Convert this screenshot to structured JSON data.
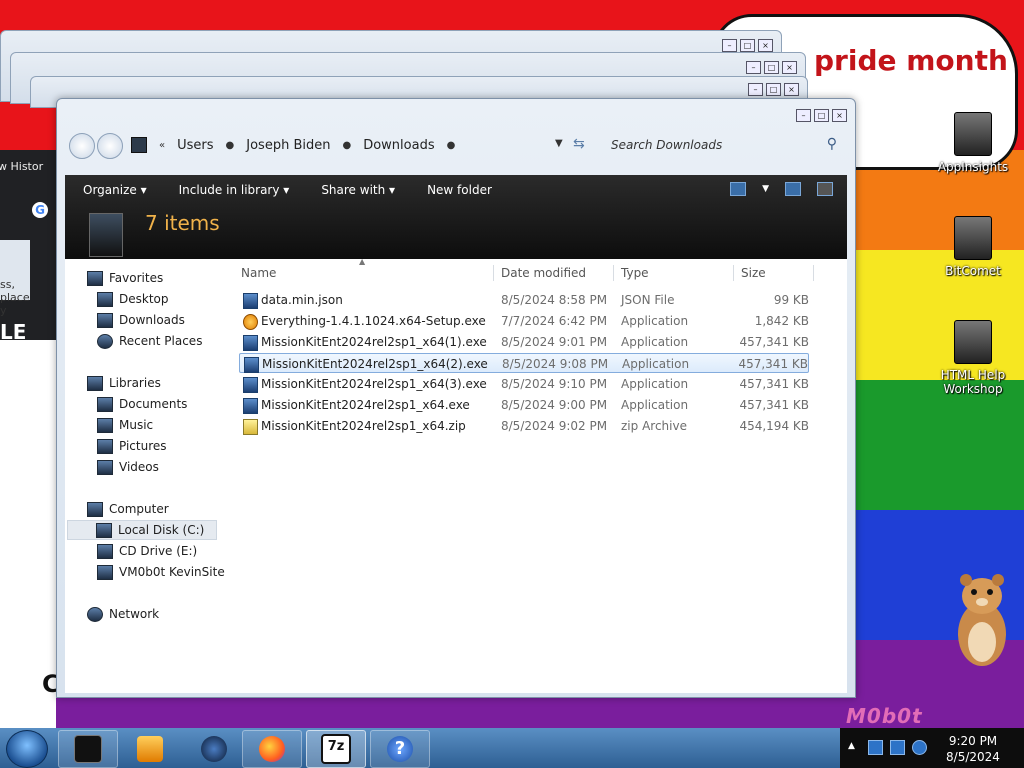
{
  "desktop": {
    "speech_text": "pride month",
    "watermark": "M0b0t",
    "icons": [
      {
        "label": "AppInsights"
      },
      {
        "label": "BitComet"
      },
      {
        "label": "HTML Help Workshop"
      }
    ],
    "browser_bg": {
      "tab_text": "w  Histor",
      "partial_text": "ss, place y",
      "big_text": "LE VI",
      "page_letter": "C"
    },
    "colors": {
      "red": "#e8141a",
      "orange": "#f37a13",
      "yellow": "#f6e721",
      "green": "#1a9a2c",
      "blue": "#1f3fd6",
      "purple": "#7a1e9d"
    }
  },
  "explorer": {
    "breadcrumb": [
      "Users",
      "Joseph Biden",
      "Downloads"
    ],
    "search_placeholder": "Search Downloads",
    "toolbar": {
      "organize": "Organize",
      "include_in_library": "Include in library",
      "share_with": "Share with",
      "new_folder": "New folder"
    },
    "item_count": "7 items",
    "nav": {
      "favorites": "Favorites",
      "desktop": "Desktop",
      "downloads": "Downloads",
      "recent_places": "Recent Places",
      "libraries": "Libraries",
      "documents": "Documents",
      "music": "Music",
      "pictures": "Pictures",
      "videos": "Videos",
      "computer": "Computer",
      "local_disk": "Local Disk (C:)",
      "cd_drive": "CD Drive (E:)",
      "vm_site": "VM0b0t KevinSite",
      "network": "Network"
    },
    "columns": {
      "name": "Name",
      "date": "Date modified",
      "type": "Type",
      "size": "Size"
    },
    "files": [
      {
        "name": "data.min.json",
        "date": "8/5/2024 8:58 PM",
        "type": "JSON File",
        "size": "99 KB"
      },
      {
        "name": "Everything-1.4.1.1024.x64-Setup.exe",
        "date": "7/7/2024 6:42 PM",
        "type": "Application",
        "size": "1,842 KB"
      },
      {
        "name": "MissionKitEnt2024rel2sp1_x64(1).exe",
        "date": "8/5/2024 9:01 PM",
        "type": "Application",
        "size": "457,341 KB"
      },
      {
        "name": "MissionKitEnt2024rel2sp1_x64(2).exe",
        "date": "8/5/2024 9:08 PM",
        "type": "Application",
        "size": "457,341 KB"
      },
      {
        "name": "MissionKitEnt2024rel2sp1_x64(3).exe",
        "date": "8/5/2024 9:10 PM",
        "type": "Application",
        "size": "457,341 KB"
      },
      {
        "name": "MissionKitEnt2024rel2sp1_x64.exe",
        "date": "8/5/2024 9:00 PM",
        "type": "Application",
        "size": "457,341 KB"
      },
      {
        "name": "MissionKitEnt2024rel2sp1_x64.zip",
        "date": "8/5/2024 9:02 PM",
        "type": "zip Archive",
        "size": "454,194 KB"
      }
    ]
  },
  "taskbar": {
    "seven_zip_label": "7z",
    "help_label": "?",
    "time": "9:20 PM",
    "date": "8/5/2024"
  }
}
